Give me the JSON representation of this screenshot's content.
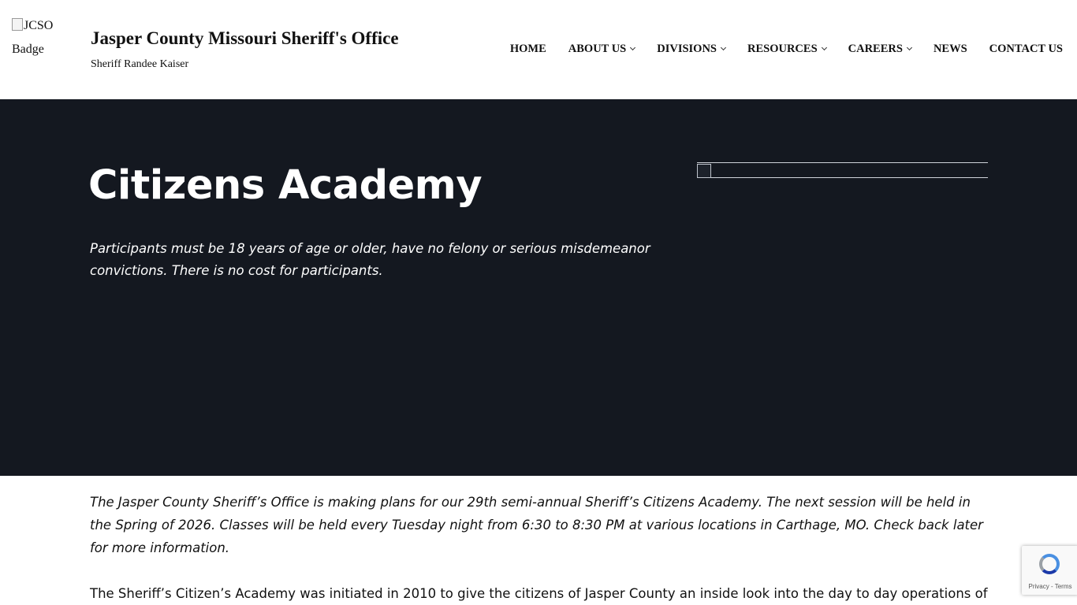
{
  "header": {
    "logo_alt": "JCSO Badge",
    "site_title": "Jasper County Missouri Sheriff's Office",
    "tagline": "Sheriff Randee Kaiser"
  },
  "nav": {
    "items": [
      {
        "label": "HOME",
        "has_dropdown": false
      },
      {
        "label": "ABOUT US",
        "has_dropdown": true
      },
      {
        "label": "DIVISIONS",
        "has_dropdown": true
      },
      {
        "label": "RESOURCES",
        "has_dropdown": true
      },
      {
        "label": "CAREERS",
        "has_dropdown": true
      },
      {
        "label": "NEWS",
        "has_dropdown": false
      },
      {
        "label": "CONTACT US",
        "has_dropdown": false
      }
    ]
  },
  "hero": {
    "title": "Citizens Academy",
    "subtitle": "Participants must be 18 years of age or older, have no felony or serious misdemeanor convictions. There is no cost for participants.",
    "background_color": "#141820"
  },
  "content": {
    "intro": "The Jasper County Sheriff’s Office is making plans for our 29th semi-annual Sheriff’s Citizens Academy. The next session will be held in the Spring of 2026. Classes will be held every Tuesday night from 6:30 to 8:30 PM at various locations in Carthage, MO. Check back later for more information.",
    "body": "The Sheriff’s Citizen’s Academy was initiated in 2010 to give the citizens of Jasper County an inside look into the day to day operations of"
  },
  "recaptcha": {
    "privacy_label": "Privacy",
    "separator": " - ",
    "terms_label": "Terms"
  }
}
